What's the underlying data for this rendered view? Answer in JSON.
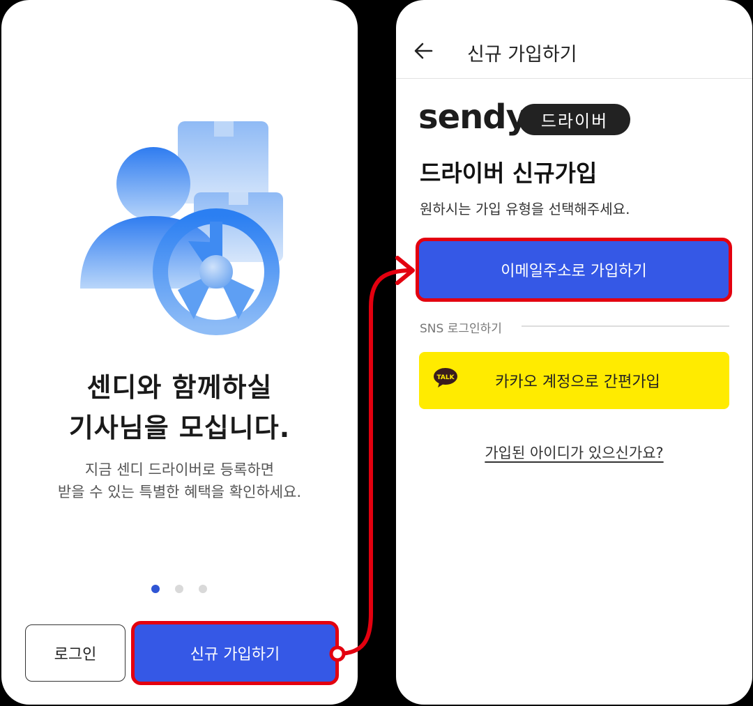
{
  "left_screen": {
    "headline_line1": "센디와 함께하실",
    "headline_line2": "기사님을 모십니다.",
    "subtext_line1": "지금 센디 드라이버로 등록하면",
    "subtext_line2": "받을 수 있는 특별한 혜택을 확인하세요.",
    "pagination": {
      "total": 3,
      "active": 1
    },
    "login_button": "로그인",
    "signup_button": "신규 가입하기"
  },
  "right_screen": {
    "title": "신규 가입하기",
    "logo_text": "sendy",
    "logo_dot": ".",
    "badge": "드라이버",
    "heading": "드라이버 신규가입",
    "description": "원하시는 가입 유형을 선택해주세요.",
    "email_button": "이메일주소로 가입하기",
    "sns_label": "SNS 로그인하기",
    "kakao_button": "카카오 계정으로 간편가입",
    "kakao_icon_text": "TALK",
    "existing_link": "가입된 아이디가 있으신가요?"
  },
  "colors": {
    "primary_blue": "#3558e6",
    "highlight_red": "#e3000f",
    "kakao_yellow": "#ffeb00"
  }
}
